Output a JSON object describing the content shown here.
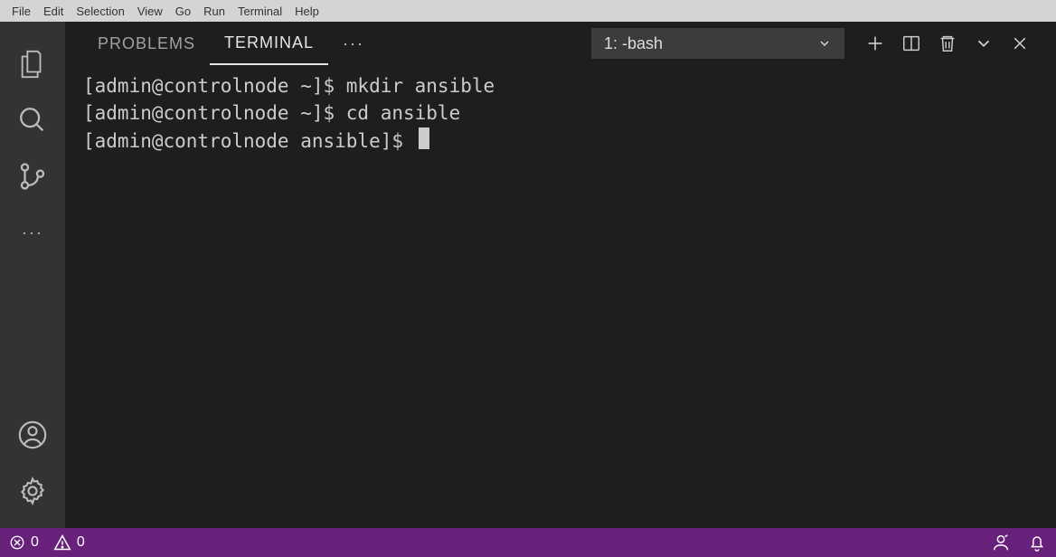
{
  "menu": {
    "items": [
      "File",
      "Edit",
      "Selection",
      "View",
      "Go",
      "Run",
      "Terminal",
      "Help"
    ]
  },
  "activitybar": {
    "top_icons": [
      "files",
      "search",
      "scm",
      "more"
    ],
    "bottom_icons": [
      "account",
      "settings"
    ]
  },
  "panel": {
    "tabs": {
      "problems": "PROBLEMS",
      "terminal": "TERMINAL"
    },
    "more": "···",
    "terminal_selector": "1: -bash",
    "actions": [
      "new",
      "split",
      "kill",
      "maximize",
      "close"
    ]
  },
  "terminal": {
    "lines": [
      "[admin@controlnode ~]$ mkdir ansible",
      "[admin@controlnode ~]$ cd ansible",
      "[admin@controlnode ansible]$ "
    ]
  },
  "statusbar": {
    "errors": "0",
    "warnings": "0"
  }
}
